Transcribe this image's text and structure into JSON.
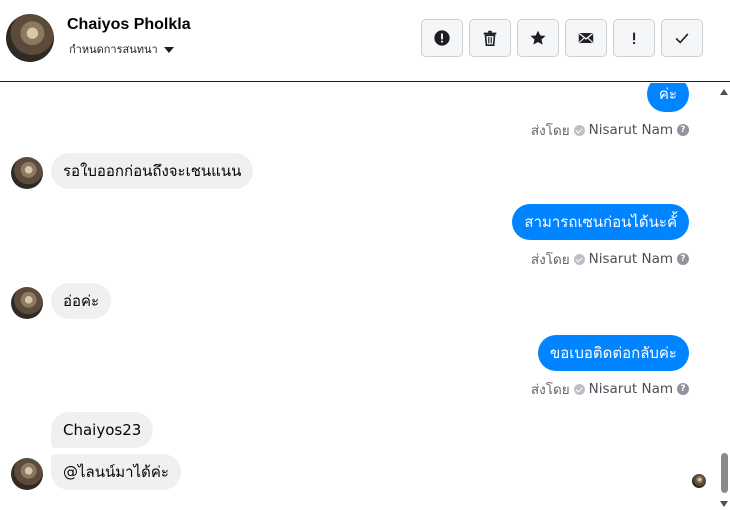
{
  "header": {
    "contact_name": "Chaiyos Pholkla",
    "options_label": "กำหนดการสนทนา",
    "toolbar": [
      {
        "icon": "alert-circle-icon",
        "name": "report-button"
      },
      {
        "icon": "trash-icon",
        "name": "delete-button"
      },
      {
        "icon": "star-icon",
        "name": "star-button"
      },
      {
        "icon": "envelope-icon",
        "name": "mark-unread-button"
      },
      {
        "icon": "exclamation-icon",
        "name": "spam-button"
      },
      {
        "icon": "checkmark-icon",
        "name": "mark-done-button"
      }
    ]
  },
  "messages": {
    "m1": {
      "direction": "out",
      "text": "ค่ะ"
    },
    "s1": {
      "prefix": "ส่งโดย",
      "agent": "Nisarut Nam"
    },
    "m2": {
      "direction": "in",
      "text": "รอใบออกก่อนถึงจะเชนแนน"
    },
    "m3": {
      "direction": "out",
      "text": "สามารถเซนก่อนได้นะคั้"
    },
    "s2": {
      "prefix": "ส่งโดย",
      "agent": "Nisarut Nam"
    },
    "m4": {
      "direction": "in",
      "text": "อ่อค่ะ"
    },
    "m5": {
      "direction": "out",
      "text": "ขอเบอติดต่อกลับค่ะ"
    },
    "s3": {
      "prefix": "ส่งโดย",
      "agent": "Nisarut Nam"
    },
    "m6": {
      "direction": "in",
      "text": "Chaiyos23"
    },
    "m7": {
      "direction": "in",
      "text": "@ไลนน์มาได้ค่ะ"
    }
  },
  "colors": {
    "outgoing_bubble": "#0084ff",
    "incoming_bubble": "#f0f0f0",
    "agent_text": "#4b4f56"
  }
}
